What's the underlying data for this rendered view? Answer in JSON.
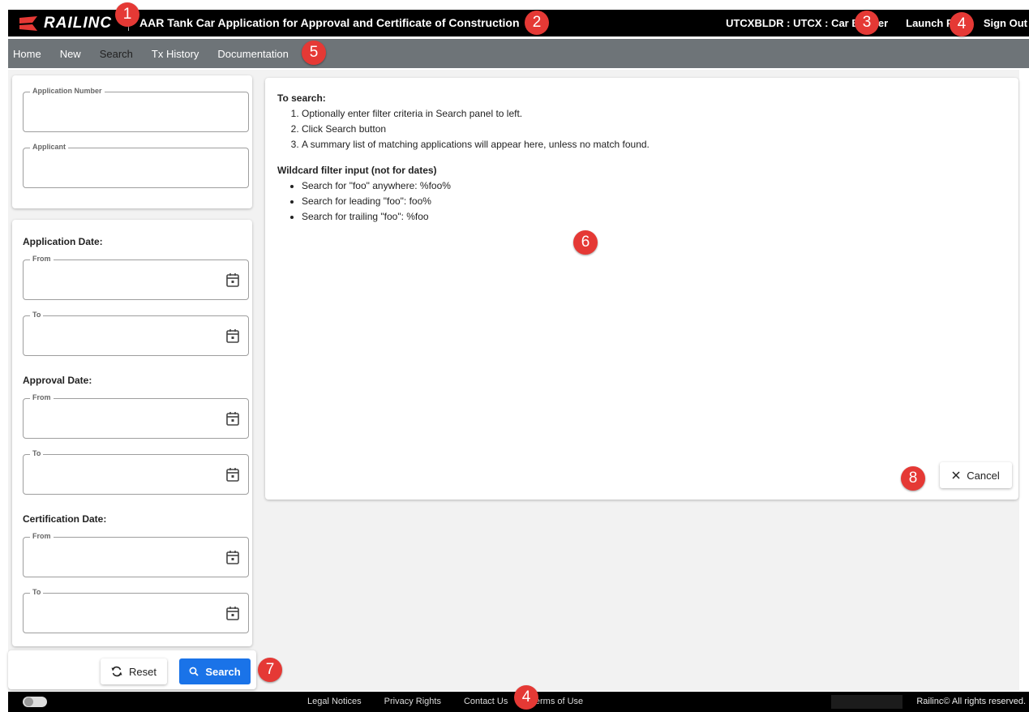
{
  "header": {
    "brand": "RAILINC",
    "app_title": "AAR Tank Car Application for Approval and Certificate of Construction",
    "user_info": "UTCXBLDR : UTCX : Car Builder",
    "launch_pad": "Launch Pad",
    "sign_out": "Sign Out"
  },
  "menu": {
    "items": [
      {
        "label": "Home"
      },
      {
        "label": "New"
      },
      {
        "label": "Search"
      },
      {
        "label": "Tx History"
      },
      {
        "label": "Documentation"
      }
    ],
    "active": "Search"
  },
  "filters": {
    "application_number": {
      "label": "Application Number",
      "value": ""
    },
    "applicant": {
      "label": "Applicant",
      "value": ""
    },
    "application_date": {
      "title": "Application Date:",
      "from": "From",
      "to": "To"
    },
    "approval_date": {
      "title": "Approval Date:",
      "from": "From",
      "to": "To"
    },
    "certification_date": {
      "title": "Certification Date:",
      "from": "From",
      "to": "To"
    }
  },
  "actions": {
    "reset": "Reset",
    "search": "Search",
    "cancel": "Cancel"
  },
  "instructions": {
    "title": "To search:",
    "steps": [
      "Optionally enter filter criteria in Search panel to left.",
      "Click Search button",
      "A summary list of matching applications will appear here, unless no match found."
    ],
    "wildcard_title": "Wildcard filter input (not for dates)",
    "wildcards": [
      "Search for \"foo\" anywhere: %foo%",
      "Search for leading \"foo\": foo%",
      "Search for trailing \"foo\": %foo"
    ]
  },
  "footer": {
    "links": [
      "Legal Notices",
      "Privacy Rights",
      "Contact Us",
      "Terms of Use"
    ],
    "copyright": "Railinc© All rights reserved."
  },
  "callouts": [
    "1",
    "2",
    "3",
    "4",
    "5",
    "6",
    "7",
    "8",
    "4"
  ],
  "colors": {
    "header_bg": "#000000",
    "menu_bg": "#6e7478",
    "primary": "#1a73e8",
    "brand_red": "#e53935",
    "callout": "#e53935"
  }
}
